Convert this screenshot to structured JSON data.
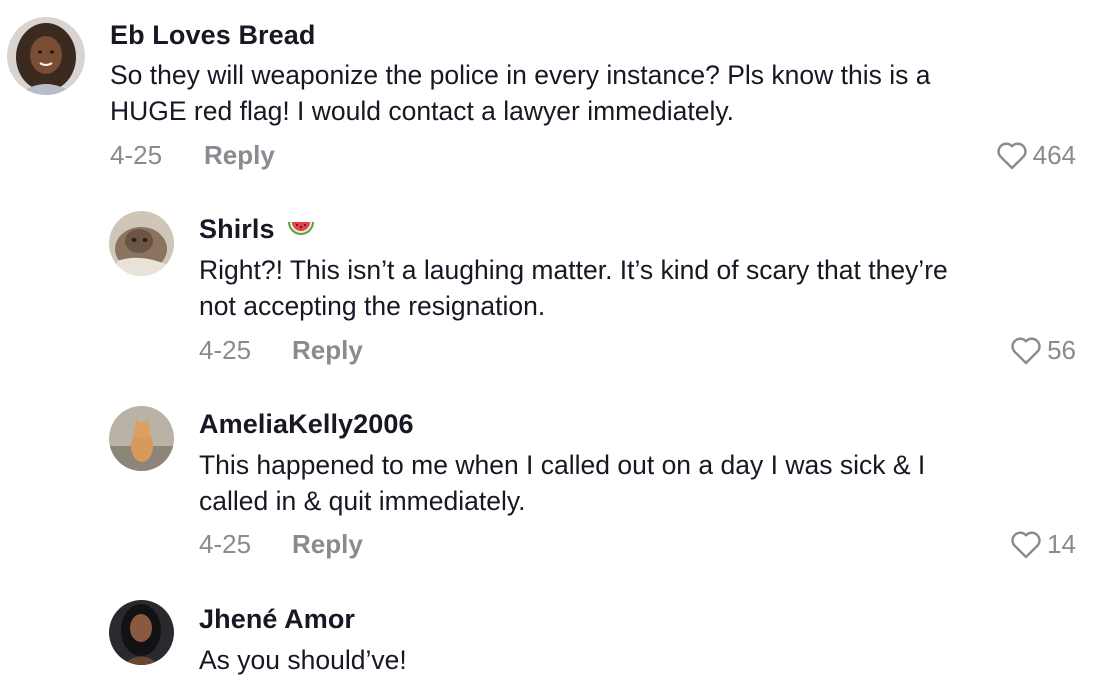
{
  "comments": [
    {
      "username": "Eb Loves Bread",
      "text_lines": [
        "So they will weaponize the police in every instance? Pls know this is a",
        "HUGE red flag! I would contact a lawyer immediately."
      ],
      "date": "4-25",
      "reply_label": "Reply",
      "likes": "464"
    },
    {
      "username": "Shirls",
      "username_emoji": "watermelon-icon",
      "text_lines": [
        "Right?! This isn’t a laughing matter. It’s kind of scary that they’re",
        "not accepting the resignation."
      ],
      "date": "4-25",
      "reply_label": "Reply",
      "likes": "56"
    },
    {
      "username": "AmeliaKelly2006",
      "text_lines": [
        "This happened to me when I called out on a day I was sick & I",
        "called in & quit immediately."
      ],
      "date": "4-25",
      "reply_label": "Reply",
      "likes": "14"
    },
    {
      "username": "Jhené Amor",
      "text_lines": [
        "As you should’ve!"
      ]
    }
  ],
  "colors": {
    "text": "#161823",
    "muted": "#8a8b91",
    "background": "#ffffff"
  }
}
